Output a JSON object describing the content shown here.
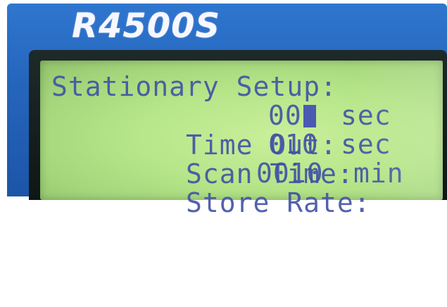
{
  "device": {
    "brand": "R4500S"
  },
  "lcd": {
    "title": "Stationary Setup:",
    "rows": [
      {
        "label": "Time Out:",
        "value": "00",
        "unit": "sec",
        "cursor": true
      },
      {
        "label": "Scan Time:",
        "value": "010",
        "unit": "sec",
        "cursor": false
      },
      {
        "label": "Store Rate:",
        "value": "0010",
        "unit": "min",
        "cursor": false
      }
    ]
  },
  "colors": {
    "device_blue": "#2566bd",
    "lcd_green": "#b6e589",
    "lcd_text": "#4150a6"
  }
}
